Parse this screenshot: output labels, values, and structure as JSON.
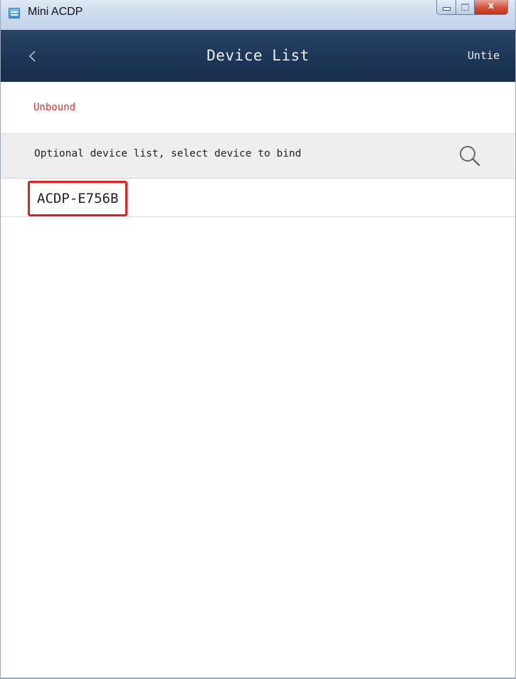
{
  "window": {
    "title": "Mini ACDP",
    "close_glyph": "x"
  },
  "navbar": {
    "back_glyph": "<",
    "title": "Device List",
    "action_label": "Untie"
  },
  "status": {
    "label": "Unbound",
    "color": "#e8302e"
  },
  "section": {
    "text": "Optional device list, select device to bind",
    "search_icon": "search-icon"
  },
  "devices": [
    {
      "name": "ACDP-E756B",
      "highlighted": true
    }
  ],
  "colors": {
    "navbar": "#1f3a5c",
    "highlight": "#e02020",
    "section_bg": "#eeeeee"
  }
}
